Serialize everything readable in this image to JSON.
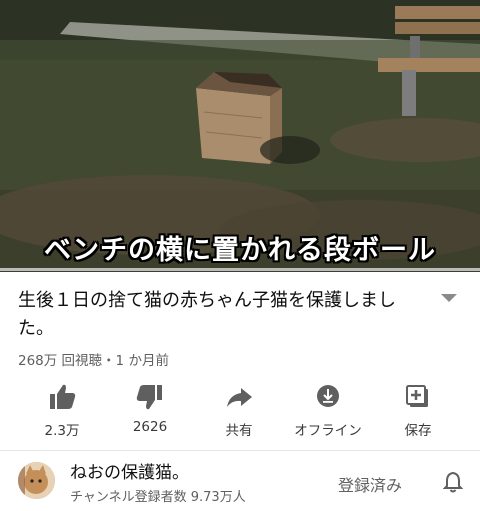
{
  "video": {
    "caption": "ベンチの横に置かれる段ボール",
    "progress": 0.0
  },
  "title": "生後１日の捨て猫の赤ちゃん子猫を保護しました。",
  "meta": {
    "views": "268万 回視聴・1 か月前"
  },
  "actions": [
    {
      "icon": "thumbs-up-icon",
      "label": "2.3万"
    },
    {
      "icon": "thumbs-down-icon",
      "label": "2626"
    },
    {
      "icon": "share-icon",
      "label": "共有"
    },
    {
      "icon": "download-icon",
      "label": "オフライン"
    },
    {
      "icon": "save-playlist-icon",
      "label": "保存"
    }
  ],
  "channel": {
    "name": "ねおの保護猫。",
    "subscribers": "チャンネル登録者数 9.73万人",
    "subscribe_state": "登録済み"
  },
  "colors": {
    "icon_gray": "#5f5f5f",
    "text_secondary": "#606060"
  }
}
